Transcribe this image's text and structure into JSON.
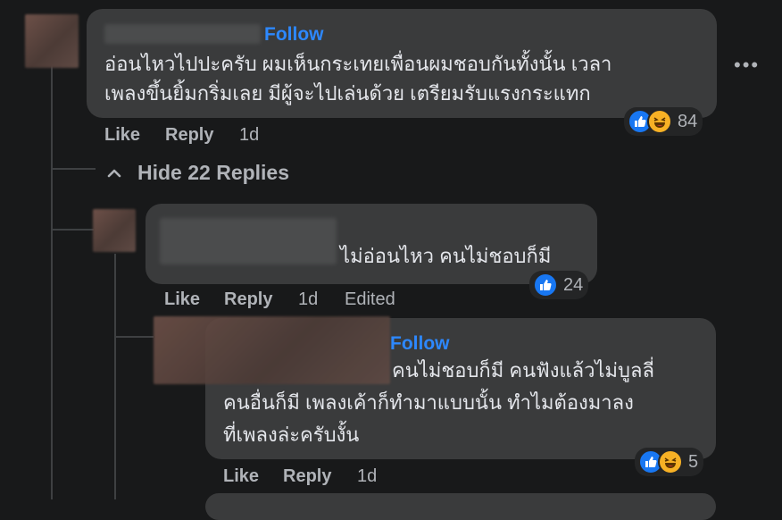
{
  "comments": [
    {
      "follow_label": "Follow",
      "text_lines": [
        "อ่อนไหวไปปะครับ ผมเห็นกระเทยเพื่อนผมชอบกันทั้งนั้น เวลา",
        "เพลงขึ้นยิ้มกริ่มเลย มีผู้จะไปเล่นด้วย เตรียมรับแรงกระแทก"
      ],
      "like_label": "Like",
      "reply_label": "Reply",
      "time": "1d",
      "reaction_count": "84"
    },
    {
      "text_lines": [
        "ไม่อ่อนไหว คนไม่ชอบก็มี"
      ],
      "like_label": "Like",
      "reply_label": "Reply",
      "time": "1d",
      "edited_label": "Edited",
      "reaction_count": "24"
    },
    {
      "follow_label": "Follow",
      "text_lines": [
        "คนไม่ชอบก็มี คนฟังแล้วไม่บูลลี่",
        "คนอื่นก็มี เพลงเค้าก็ทำมาแบบนั้น ทำไมต้องมาลง",
        "ที่เพลงล่ะครับงั้น"
      ],
      "like_label": "Like",
      "reply_label": "Reply",
      "time": "1d",
      "reaction_count": "5"
    }
  ],
  "hide_replies_label": "Hide 22 Replies",
  "more_label": "•••",
  "colors": {
    "background": "#18191a",
    "bubble": "#3a3b3c",
    "link": "#2d88ff",
    "secondary_text": "#b0b3b8"
  },
  "icons": [
    "like-icon",
    "haha-icon",
    "chevron-up-icon",
    "more-options-icon"
  ]
}
